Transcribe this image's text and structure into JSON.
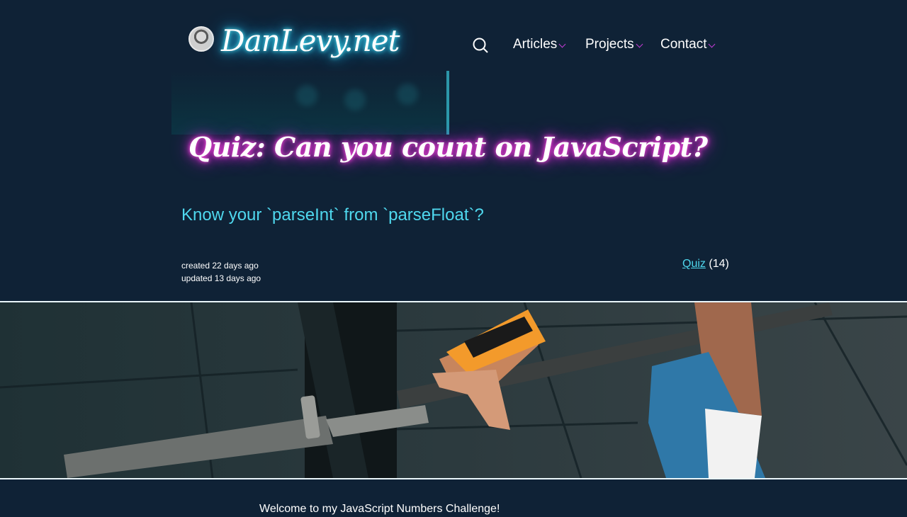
{
  "header": {
    "logo_text": "DanLevy.net",
    "nav": [
      {
        "label": "Articles"
      },
      {
        "label": "Projects"
      },
      {
        "label": "Contact"
      }
    ]
  },
  "article": {
    "title": "Quiz: Can you count on JavaScript?",
    "subtitle": "Know your `parseInt` from `parseFloat`?",
    "created": "created 22 days ago",
    "updated": "updated 13 days ago",
    "tag": {
      "label": "Quiz",
      "count": "(14)"
    },
    "intro": "Welcome to my JavaScript Numbers Challenge!"
  },
  "colors": {
    "background": "#0f2236",
    "accent_cyan": "#4fd8ee",
    "accent_magenta": "#c23bd4"
  }
}
